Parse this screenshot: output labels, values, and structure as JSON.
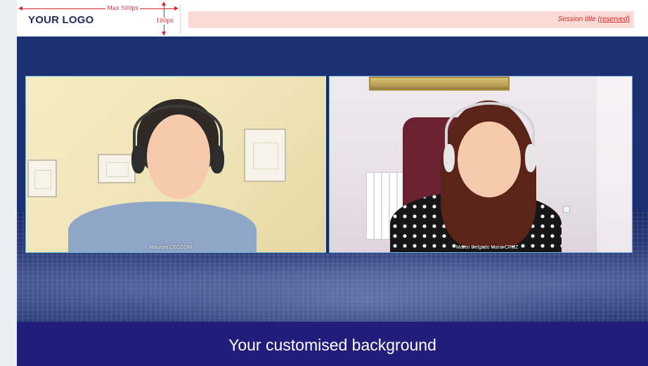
{
  "header": {
    "logo_text": "YOUR LOGO",
    "width_label": "Max 500px",
    "height_label": "100px",
    "session_title_prefix": "Session title ",
    "session_title_reserved": "(reserved)"
  },
  "videos": [
    {
      "name": "Maurizio CECCONI"
    },
    {
      "name": "Martin Delgado Maria CRUZ"
    }
  ],
  "banner": {
    "text": "Your customised background"
  },
  "colors": {
    "background_blue": "#1d3072",
    "banner_blue": "#211d7a",
    "annotation_red": "#d9272e",
    "session_bar_pink": "#fbd9d5",
    "face_placeholder": "#f7c9ad"
  }
}
